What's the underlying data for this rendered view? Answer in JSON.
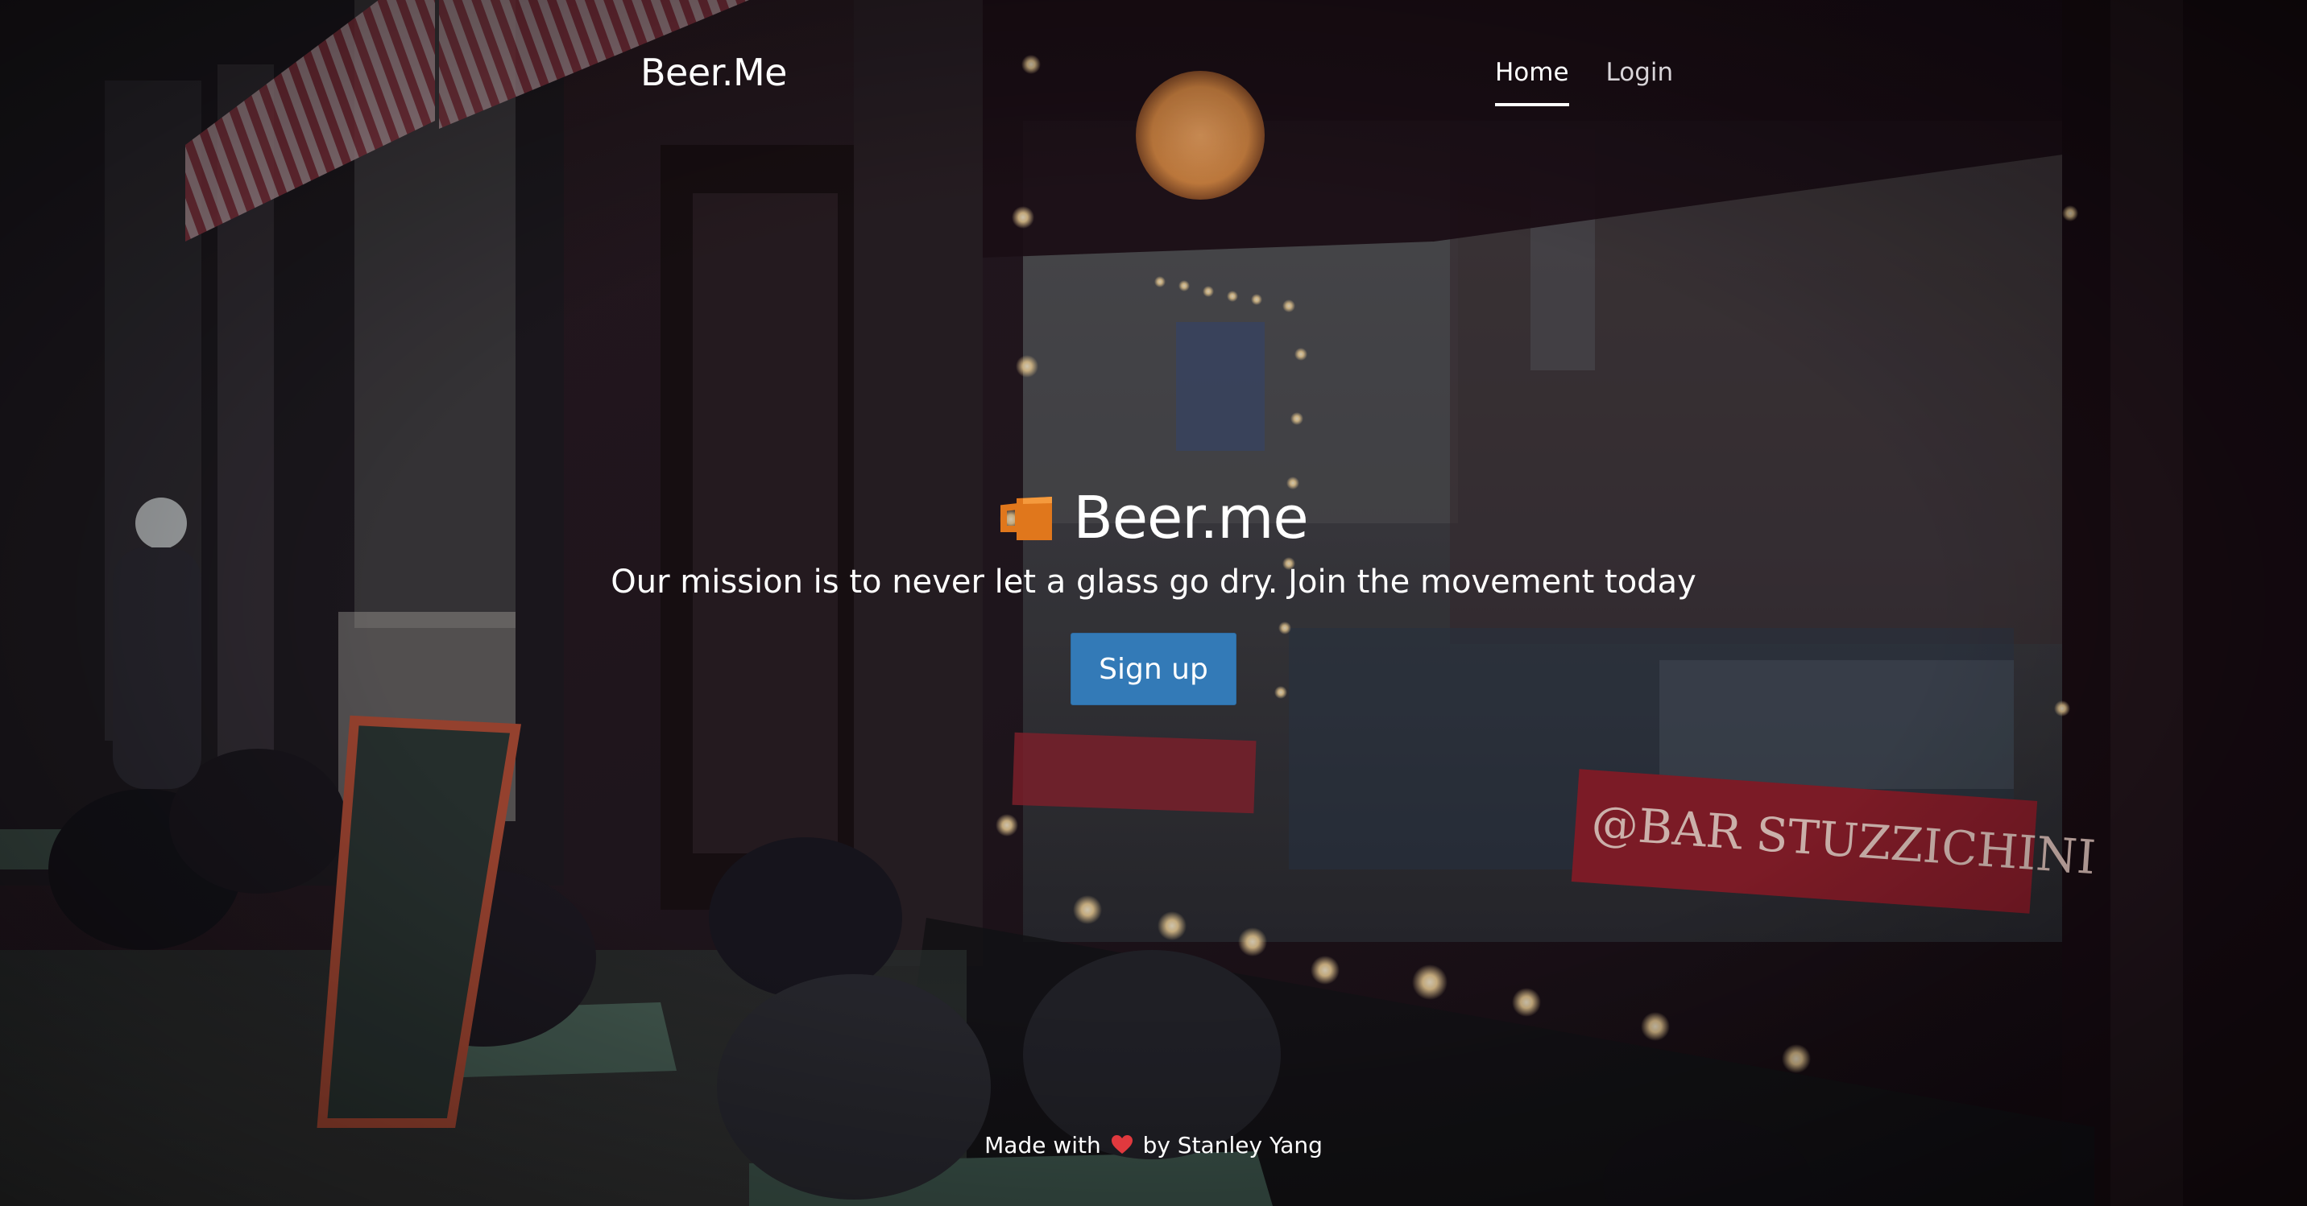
{
  "navbar": {
    "brand": "Beer.Me",
    "links": [
      {
        "label": "Home",
        "active": true
      },
      {
        "label": "Login",
        "active": false
      }
    ]
  },
  "hero": {
    "icon": "beer-mug-icon",
    "title": "Beer.me",
    "subtitle": "Our mission is to never let a glass go dry. Join the movement today",
    "signup_label": "Sign up"
  },
  "footer": {
    "prefix": "Made with",
    "icon": "heart-icon",
    "suffix": "by Stanley Yang"
  },
  "colors": {
    "accent_button": "#337ab7",
    "icon_orange": "#e0771c",
    "heart_red": "#e0393e"
  }
}
